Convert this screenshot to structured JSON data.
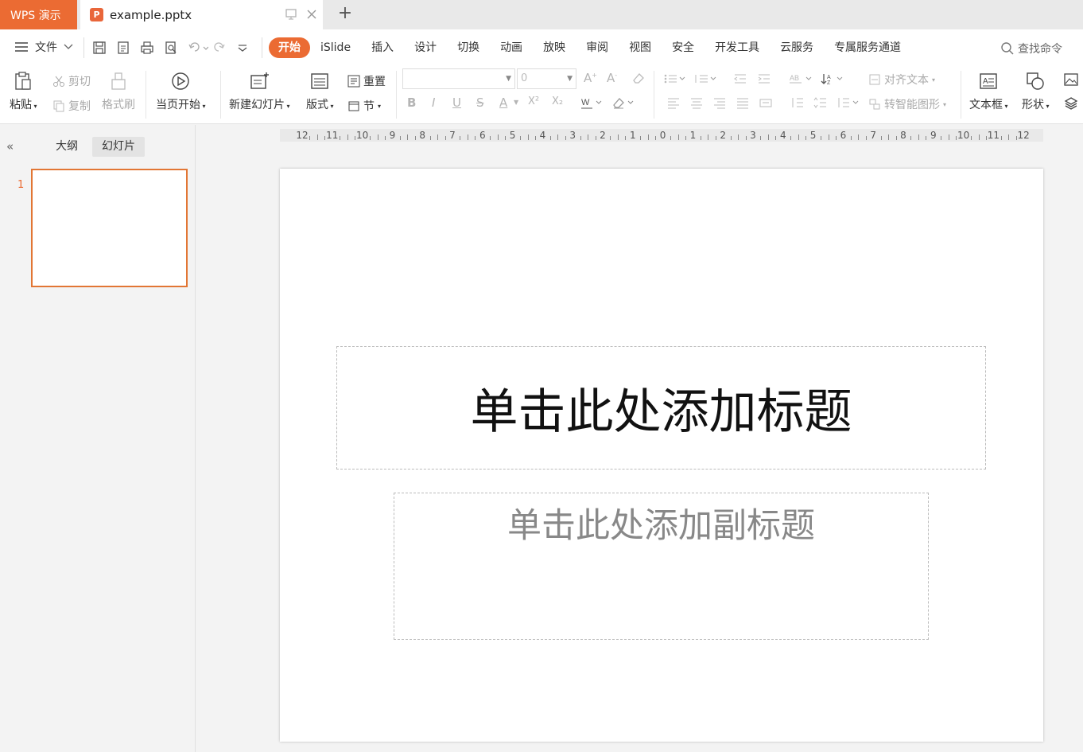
{
  "app": {
    "name": "WPS 演示"
  },
  "document": {
    "tab_title": "example.pptx",
    "icon_letter": "P",
    "new_tab": "+"
  },
  "menu": {
    "file_label": "文件",
    "tabs": [
      "开始",
      "iSlide",
      "插入",
      "设计",
      "切换",
      "动画",
      "放映",
      "审阅",
      "视图",
      "安全",
      "开发工具",
      "云服务",
      "专属服务通道"
    ],
    "active_tab": "开始",
    "search_label": "查找命令"
  },
  "ribbon": {
    "paste": "粘贴",
    "cut": "剪切",
    "copy": "复制",
    "format_painter": "格式刷",
    "start_from_current": "当页开始",
    "new_slide": "新建幻灯片",
    "layout": "版式",
    "reset": "重置",
    "section": "节",
    "font_name": "",
    "font_size": "0",
    "align_text": "对齐文本",
    "smart_art": "转智能图形",
    "text_box": "文本框",
    "shape": "形状",
    "format_buttons": [
      "B",
      "I",
      "U",
      "S",
      "A",
      "X²",
      "X₂"
    ]
  },
  "left_panel": {
    "tabs": [
      "大纲",
      "幻灯片"
    ],
    "active_tab": "幻灯片",
    "collapse": "«",
    "slides": [
      {
        "number": "1"
      }
    ]
  },
  "ruler": {
    "labels": [
      "12",
      "11",
      "10",
      "9",
      "8",
      "7",
      "6",
      "5",
      "4",
      "3",
      "2",
      "1",
      "0",
      "1",
      "2",
      "3",
      "4",
      "5",
      "6",
      "7",
      "8",
      "9",
      "10",
      "11",
      "12"
    ]
  },
  "slide": {
    "title_placeholder": "单击此处添加标题",
    "subtitle_placeholder": "单击此处添加副标题"
  },
  "colors": {
    "accent": "#eb6b33",
    "selected_border": "#e27634"
  }
}
